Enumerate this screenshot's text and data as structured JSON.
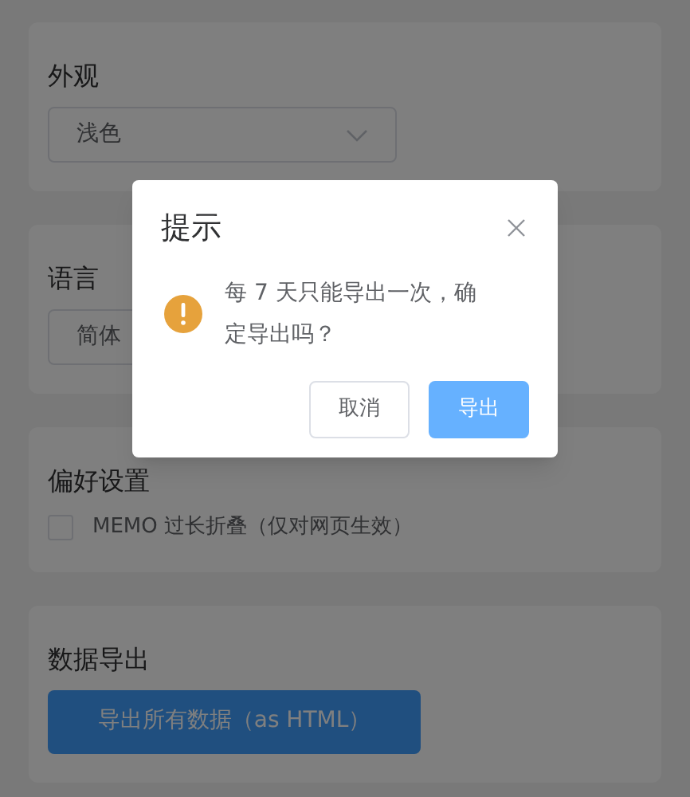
{
  "sections": [
    {
      "kind": "select",
      "title": "外观",
      "value": "浅色",
      "chevron": true
    },
    {
      "kind": "select",
      "title": "语言",
      "value": "简体"
    },
    {
      "kind": "checkbox",
      "title": "偏好设置",
      "label": "MEMO 过长折叠（仅对网页生效）",
      "checked": false
    },
    {
      "kind": "button",
      "title": "数据导出",
      "button": "导出所有数据（as HTML）"
    }
  ],
  "dialog": {
    "title": "提示",
    "message": "每 7 天只能导出一次，确定导出吗？",
    "buttons": [
      {
        "label": "取消",
        "kind": "default"
      },
      {
        "label": "导出",
        "kind": "primary"
      }
    ]
  }
}
